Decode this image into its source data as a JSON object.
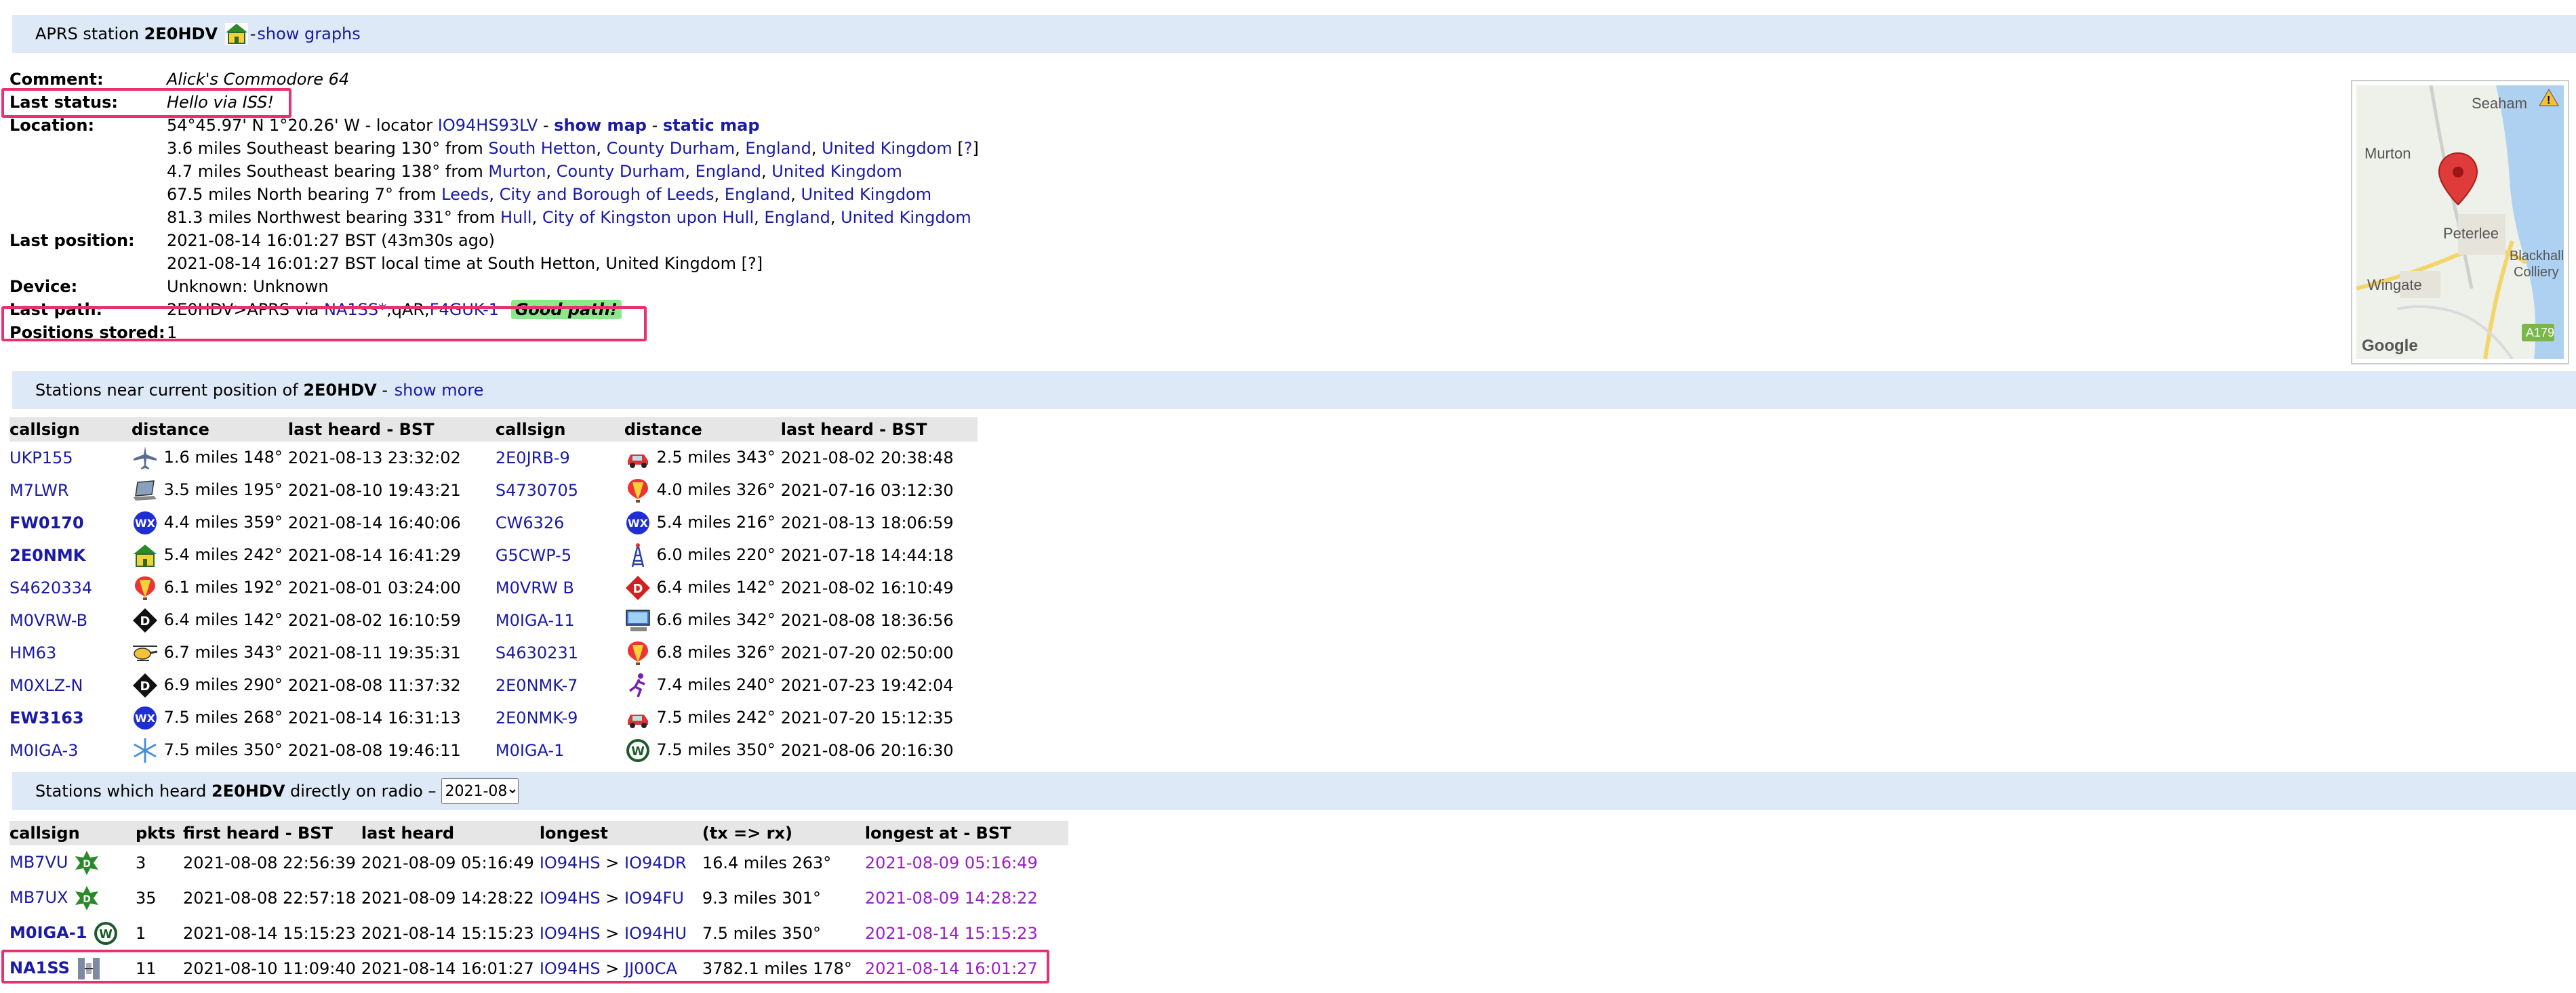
{
  "header": {
    "prefix": "APRS station",
    "callsign": "2E0HDV",
    "icon": "house-icon",
    "sep": " - ",
    "graphs_link": "show graphs"
  },
  "info": {
    "comment_label": "Comment:",
    "comment_value": "Alick's Commodore 64",
    "status_label": "Last status:",
    "status_value": "Hello via ISS!",
    "location_label": "Location:",
    "location_coords": "54°45.97' N 1°20.26' W - locator",
    "locator": "IO94HS93LV",
    "show_map": "show map",
    "static_map": "static map",
    "loc_lines": [
      {
        "prefix": "3.6 miles Southeast bearing 130° from",
        "place": "South Hetton",
        "county": "County Durham",
        "region": "England",
        "country": "United Kingdom",
        "extra": "?"
      },
      {
        "prefix": "4.7 miles Southeast bearing 138° from",
        "place": "Murton",
        "county": "County Durham",
        "region": "England",
        "country": "United Kingdom"
      },
      {
        "prefix": "67.5 miles North bearing 7° from",
        "place": "Leeds",
        "county": "City and Borough of Leeds",
        "region": "England",
        "country": "United Kingdom"
      },
      {
        "prefix": "81.3 miles Northwest bearing 331° from",
        "place": "Hull",
        "county": "City of Kingston upon Hull",
        "region": "England",
        "country": "United Kingdom"
      }
    ],
    "position_label": "Last position:",
    "position_line1": "2021-08-14 16:01:27 BST (43m30s ago)",
    "position_line2": "2021-08-14 16:01:27 BST local time at South Hetton, United Kingdom [?]",
    "device_label": "Device:",
    "device_value": "Unknown: Unknown",
    "path_label": "Last path:",
    "path_prefix": "2E0HDV>APRS via",
    "path_hop1": "NA1SS*",
    "path_mid": ",qAR,",
    "path_hop2": "F4GUK-1",
    "path_badge": "Good path!",
    "stored_label": "Positions stored:",
    "stored_value": "1"
  },
  "map": {
    "labels": [
      "Seaham",
      "Murton",
      "Peterlee",
      "Blackhall",
      "Colliery",
      "Wingate",
      "A179",
      "Google"
    ],
    "pin_color": "#e03b3b",
    "sea_color": "#aed1f2"
  },
  "near": {
    "title_prefix": "Stations near current position of",
    "callsign": "2E0HDV",
    "show_more": "show more",
    "headers": [
      "callsign",
      "distance",
      "last heard - BST",
      "callsign",
      "distance",
      "last heard - BST"
    ],
    "rows": [
      {
        "c1": "UKP155",
        "b1": false,
        "i1": "plane-icon",
        "d1": "1.6 miles 148°",
        "t1": "2021-08-13 23:32:02",
        "c2": "2E0JRB-9",
        "b2": false,
        "i2": "car-icon",
        "d2": "2.5 miles 343°",
        "t2": "2021-08-02 20:38:48"
      },
      {
        "c1": "M7LWR",
        "b1": false,
        "i1": "laptop-icon",
        "d1": "3.5 miles 195°",
        "t1": "2021-08-10 19:43:21",
        "c2": "S4730705",
        "b2": false,
        "i2": "balloon-icon",
        "d2": "4.0 miles 326°",
        "t2": "2021-07-16 03:12:30"
      },
      {
        "c1": "FW0170",
        "b1": true,
        "i1": "wx-icon",
        "d1": "4.4 miles 359°",
        "t1": "2021-08-14 16:40:06",
        "c2": "CW6326",
        "b2": false,
        "i2": "wx-icon",
        "d2": "5.4 miles 216°",
        "t2": "2021-08-13 18:06:59"
      },
      {
        "c1": "2E0NMK",
        "b1": true,
        "i1": "house-icon",
        "d1": "5.4 miles 242°",
        "t1": "2021-08-14 16:41:29",
        "c2": "G5CWP-5",
        "b2": false,
        "i2": "tower-icon",
        "d2": "6.0 miles 220°",
        "t2": "2021-07-18 14:44:18"
      },
      {
        "c1": "S4620334",
        "b1": false,
        "i1": "balloon-icon",
        "d1": "6.1 miles 192°",
        "t1": "2021-08-01 03:24:00",
        "c2": "M0VRW B",
        "b2": false,
        "i2": "dstar-red-icon",
        "d2": "6.4 miles 142°",
        "t2": "2021-08-02 16:10:49"
      },
      {
        "c1": "M0VRW-B",
        "b1": false,
        "i1": "dstar-black-icon",
        "d1": "6.4 miles 142°",
        "t1": "2021-08-02 16:10:59",
        "c2": "M0IGA-11",
        "b2": false,
        "i2": "computer-icon",
        "d2": "6.6 miles 342°",
        "t2": "2021-08-08 18:36:56"
      },
      {
        "c1": "HM63",
        "b1": false,
        "i1": "helicopter-icon",
        "d1": "6.7 miles 343°",
        "t1": "2021-08-11 19:35:31",
        "c2": "S4630231",
        "b2": false,
        "i2": "balloon-icon",
        "d2": "6.8 miles 326°",
        "t2": "2021-07-20 02:50:00"
      },
      {
        "c1": "M0XLZ-N",
        "b1": false,
        "i1": "dstar-black-icon",
        "d1": "6.9 miles 290°",
        "t1": "2021-08-08 11:37:32",
        "c2": "2E0NMK-7",
        "b2": false,
        "i2": "runner-icon",
        "d2": "7.4 miles 240°",
        "t2": "2021-07-23 19:42:04"
      },
      {
        "c1": "EW3163",
        "b1": true,
        "i1": "wx-icon",
        "d1": "7.5 miles 268°",
        "t1": "2021-08-14 16:31:13",
        "c2": "2E0NMK-9",
        "b2": false,
        "i2": "car-icon",
        "d2": "7.5 miles 242°",
        "t2": "2021-07-20 15:12:35"
      },
      {
        "c1": "M0IGA-3",
        "b1": false,
        "i1": "snowflake-icon",
        "d1": "7.5 miles 350°",
        "t1": "2021-08-08 19:46:11",
        "c2": "M0IGA-1",
        "b2": false,
        "i2": "w-digi-icon",
        "d2": "7.5 miles 350°",
        "t2": "2021-08-06 20:16:30"
      }
    ]
  },
  "heard": {
    "title_prefix": "Stations which heard",
    "callsign": "2E0HDV",
    "title_suffix": "directly on radio –",
    "month": "2021-08",
    "headers": [
      "callsign",
      "pkts",
      "first heard - BST",
      "last heard",
      "longest",
      "(tx => rx)",
      "longest at - BST"
    ],
    "rows": [
      {
        "call": "MB7VU",
        "bold": false,
        "icon": "digi-star-icon",
        "pkts": "3",
        "first": "2021-08-08 22:56:39",
        "last": "2021-08-09 05:16:49",
        "tx": "IO94HS",
        "rx": "IO94DR",
        "dist": "16.4 miles 263°",
        "at": "2021-08-09 05:16:49"
      },
      {
        "call": "MB7UX",
        "bold": false,
        "icon": "digi-star-icon",
        "pkts": "35",
        "first": "2021-08-08 22:57:18",
        "last": "2021-08-09 14:28:22",
        "tx": "IO94HS",
        "rx": "IO94FU",
        "dist": "9.3 miles 301°",
        "at": "2021-08-09 14:28:22"
      },
      {
        "call": "M0IGA-1",
        "bold": true,
        "icon": "w-digi-icon",
        "pkts": "1",
        "first": "2021-08-14 15:15:23",
        "last": "2021-08-14 15:15:23",
        "tx": "IO94HS",
        "rx": "IO94HU",
        "dist": "7.5 miles 350°",
        "at": "2021-08-14 15:15:23"
      },
      {
        "call": "NA1SS",
        "bold": true,
        "icon": "satellite-icon",
        "pkts": "11",
        "first": "2021-08-10 11:09:40",
        "last": "2021-08-14 16:01:27",
        "tx": "IO94HS",
        "rx": "JJ00CA",
        "dist": "3782.1 miles 178°",
        "at": "2021-08-14 16:01:27"
      }
    ],
    "arrow": ">"
  }
}
